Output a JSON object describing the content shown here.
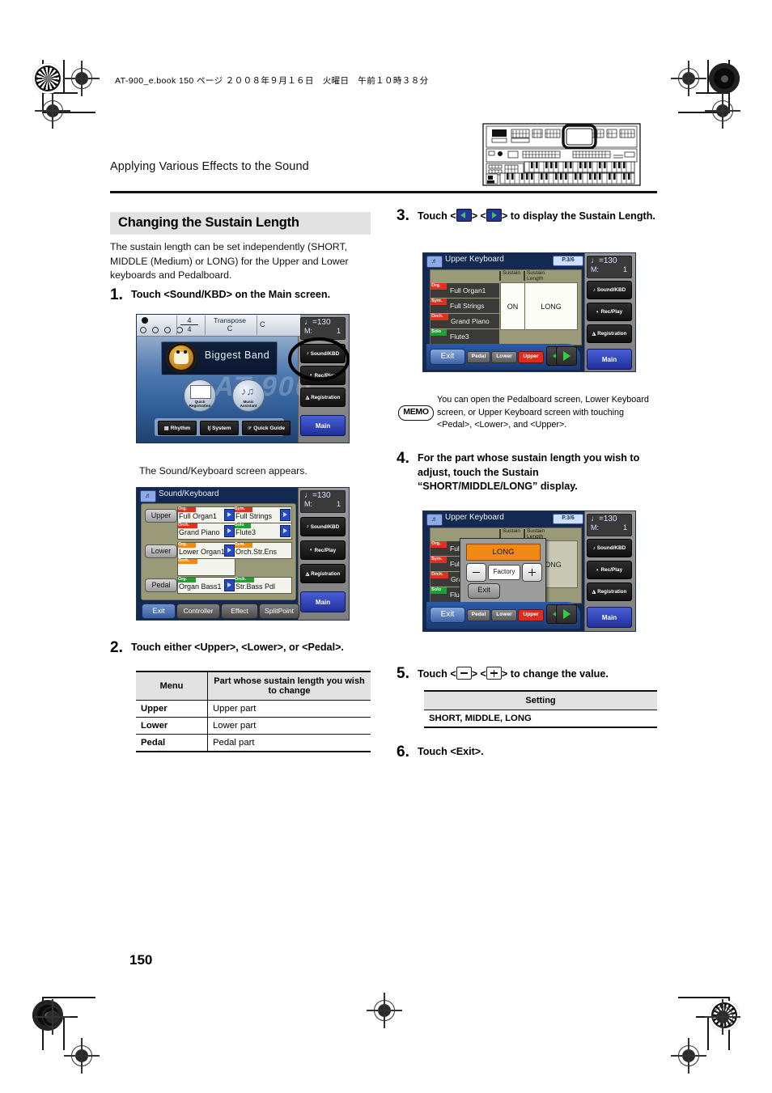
{
  "print": {
    "book_line": "AT-900_e.book  150 ページ  ２００８年９月１６日　火曜日　午前１０時３８分"
  },
  "header": {
    "running_head": "Applying Various Effects to the Sound",
    "organ_illustration": "organ-panel-illustration"
  },
  "section": {
    "title": "Changing the Sustain Length"
  },
  "intro": "The sustain length can be set independently (SHORT, MIDDLE (Medium) or LONG) for the Upper and Lower keyboards and Pedalboard.",
  "steps": {
    "s1": {
      "num": "1.",
      "text": "Touch <Sound/KBD> on the Main screen."
    },
    "s1_caption": "The Sound/Keyboard screen appears.",
    "s2": {
      "num": "2.",
      "text": "Touch either <Upper>, <Lower>, or <Pedal>."
    },
    "s3": {
      "num": "3.",
      "pre": "Touch <",
      "mid": "> <",
      "post": "> to display the Sustain Length."
    },
    "s4": {
      "num": "4.",
      "text": "For the part whose sustain length you wish to adjust, touch the Sustain “SHORT/MIDDLE/LONG” display."
    },
    "s5": {
      "num": "5.",
      "pre": "Touch <",
      "mid": "> <",
      "post": "> to change the value."
    },
    "s6": {
      "num": "6.",
      "text": "Touch <Exit>."
    }
  },
  "memo": {
    "label": "MEMO",
    "text": "You can open the Pedalboard screen, Lower Keyboard screen, or Upper Keyboard screen with touching <Pedal>, <Lower>, and <Upper>."
  },
  "menu_table": {
    "headers": [
      "Menu",
      "Part whose sustain length you wish to change"
    ],
    "rows": [
      [
        "Upper",
        "Upper part"
      ],
      [
        "Lower",
        "Lower part"
      ],
      [
        "Pedal",
        "Pedal part"
      ]
    ]
  },
  "setting_table": {
    "header": "Setting",
    "rows": [
      "SHORT, MIDDLE, LONG"
    ]
  },
  "page_number": "150",
  "main_screen": {
    "beat_numerator": "4",
    "beat_denominator": "4",
    "transpose_label": "Transpose",
    "transpose_value": "C",
    "key_value": "C",
    "tempo": "=130",
    "measure_label": "M:",
    "measure_value": "1",
    "title": "Biggest Band",
    "badge_text": "Biggest Band",
    "icon_quick_registration": "Quick\nRegistration",
    "quick_registration_l1": "Quick",
    "quick_registration_l2": "Registration",
    "music_assistant_l1": "Music",
    "music_assistant_l2": "Assistant",
    "bottom_buttons": [
      "Rhythm",
      "System",
      "Quick Guide"
    ],
    "side_buttons": [
      "Sound/KBD",
      "Rec/Play",
      "Registration"
    ],
    "main_button": "Main"
  },
  "sound_keyboard_screen": {
    "title": "Sound/Keyboard",
    "tempo": "=130",
    "measure_label": "M:",
    "measure_value": "1",
    "parts": [
      {
        "name": "Upper",
        "slots": [
          {
            "tag": "Org.",
            "tag_color": "#e03020",
            "value": "Full Organ1",
            "arrow": true
          },
          {
            "tag": "Sym.",
            "tag_color": "#e03020",
            "value": "Full Strings",
            "arrow": true
          },
          {
            "tag": "Orch.",
            "tag_color": "#e03020",
            "value": "Grand Piano",
            "arrow": true
          },
          {
            "tag": "Solo",
            "tag_color": "#1f9f34",
            "value": "Flute3",
            "arrow": true
          }
        ]
      },
      {
        "name": "Lower",
        "slots": [
          {
            "tag": "Org.",
            "tag_color": "#f08a12",
            "value": "Lower Organ1",
            "arrow": true
          },
          {
            "tag": "Sym.",
            "tag_color": "#f08a12",
            "value": "Orch.Str.Ens",
            "arrow": false
          },
          {
            "tag": "Orch.",
            "tag_color": "#f08a12",
            "value": "",
            "arrow": false
          },
          {
            "tag": "",
            "tag_color": "",
            "value": "",
            "arrow": false
          }
        ]
      },
      {
        "name": "Pedal",
        "slots": [
          {
            "tag": "Org.",
            "tag_color": "#1f9f34",
            "value": "Organ Bass1",
            "arrow": true
          },
          {
            "tag": "Orch.",
            "tag_color": "#1f9f34",
            "value": "Str.Bass Pdl",
            "arrow": false
          }
        ]
      }
    ],
    "bottom_buttons": [
      "Exit",
      "Controller",
      "Effect",
      "SplitPoint"
    ],
    "side_buttons": [
      "Sound/KBD",
      "Rec/Play",
      "Registration"
    ],
    "main_button": "Main"
  },
  "upper_keyboard_screen": {
    "title": "Upper Keyboard",
    "page_badge": "P.3/6",
    "tempo": "=130",
    "measure_label": "M:",
    "measure_value": "1",
    "col_headers": [
      "Sustain",
      "Sustain Length"
    ],
    "col_header_1": "Sustain",
    "col_header_2a": "Sustain",
    "col_header_2b": "Length",
    "rows": [
      {
        "tag": "Org.",
        "tag_color": "#e03020",
        "name": "Full Organ1"
      },
      {
        "tag": "Sym.",
        "tag_color": "#e03020",
        "name": "Full Strings"
      },
      {
        "tag": "Orch.",
        "tag_color": "#e03020",
        "name": "Grand Piano"
      },
      {
        "tag": "Solo",
        "tag_color": "#1f9f34",
        "name": "Flute3"
      }
    ],
    "sustain_value": "ON",
    "sustain_length_value": "LONG",
    "exit_button": "Exit",
    "part_tabs": [
      "Pedal",
      "Lower",
      "Upper"
    ],
    "active_part_tab": "Upper",
    "side_buttons": [
      "Sound/KBD",
      "Rec/Play",
      "Registration"
    ],
    "main_button": "Main"
  },
  "upper_keyboard_popup_screen": {
    "title": "Upper Keyboard",
    "page_badge": "P.3/6",
    "tempo": "=130",
    "measure_label": "M:",
    "measure_value": "1",
    "col_header_1": "Sustain",
    "col_header_2a": "Sustain",
    "col_header_2b": "Length",
    "rows": [
      {
        "tag": "Org.",
        "tag_color": "#e03020",
        "name": "Full"
      },
      {
        "tag": "Sym.",
        "tag_color": "#e03020",
        "name": "Full"
      },
      {
        "tag": "Orch.",
        "tag_color": "#e03020",
        "name": "Gra"
      },
      {
        "tag": "Solo",
        "tag_color": "#1f9f34",
        "name": "Flu"
      }
    ],
    "behind_value": "LONG",
    "popup": {
      "value": "LONG",
      "minus_button": "-",
      "factory_button": "Factory",
      "plus_button": "+",
      "exit_button": "Exit"
    },
    "exit_button": "Exit",
    "part_tabs": [
      "Pedal",
      "Lower",
      "Upper"
    ],
    "active_part_tab": "Upper",
    "side_buttons": [
      "Sound/KBD",
      "Rec/Play",
      "Registration"
    ],
    "main_button": "Main"
  },
  "colors": {
    "lcd_bg": "#13294f",
    "lcd_panel": "#9a9a78",
    "accent_orange": "#f08a12",
    "accent_red": "#e03020",
    "accent_green": "#1f9f34",
    "main_blue": "#2a3fbd"
  }
}
